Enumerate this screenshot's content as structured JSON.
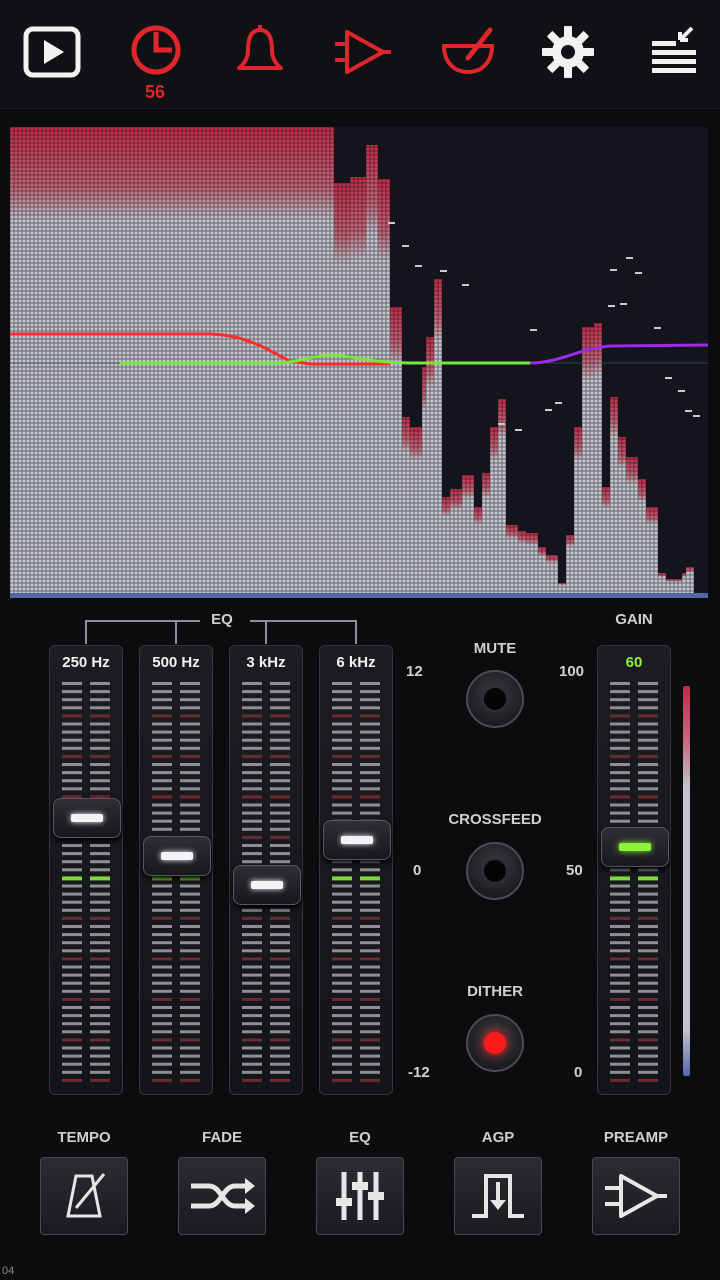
{
  "toolbar": {
    "icons": [
      "play-icon",
      "timer-icon",
      "bell-icon",
      "amplifier-icon",
      "mortar-icon",
      "gear-icon",
      "queue-icon"
    ],
    "timer_count": "56",
    "accent_red": "#e0262c",
    "white": "#f2f2f2"
  },
  "eq": {
    "section_label": "EQ",
    "bands": [
      {
        "label": "250 Hz",
        "value": 4.2
      },
      {
        "label": "500 Hz",
        "value": 1.8
      },
      {
        "label": "3 kHz",
        "value": 0.0
      },
      {
        "label": "6 kHz",
        "value": 2.8
      }
    ],
    "scale": {
      "top": "12",
      "mid": "0",
      "bottom": "-12"
    }
  },
  "controls": {
    "mute_label": "MUTE",
    "crossfeed_label": "CROSSFEED",
    "dither_label": "DITHER",
    "dither_on": true
  },
  "gain": {
    "label": "GAIN",
    "value": "60",
    "scale": {
      "top": "100",
      "mid": "50",
      "bottom": "0"
    },
    "value_color": "#8ef23a"
  },
  "bottom": {
    "buttons": [
      {
        "label": "TEMPO",
        "icon": "metronome-icon"
      },
      {
        "label": "FADE",
        "icon": "shuffle-icon"
      },
      {
        "label": "EQ",
        "icon": "sliders-icon"
      },
      {
        "label": "AGP",
        "icon": "gate-icon"
      },
      {
        "label": "PREAMP",
        "icon": "amplifier-icon"
      }
    ]
  },
  "corner_text": "04"
}
